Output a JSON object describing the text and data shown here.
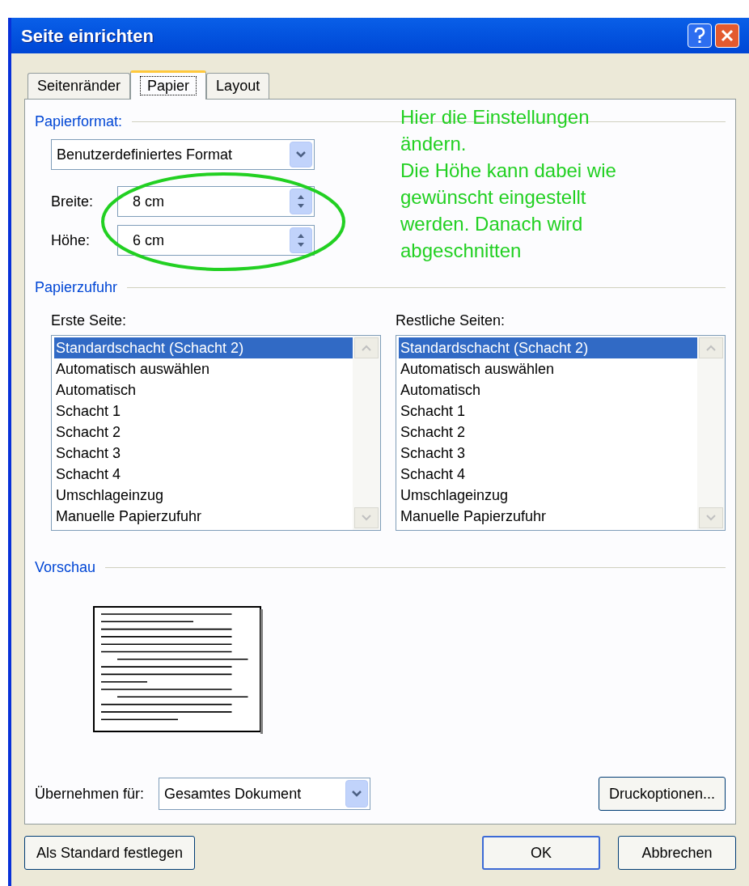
{
  "window": {
    "title": "Seite einrichten"
  },
  "tabs": [
    {
      "label": "Seitenränder",
      "selected": false
    },
    {
      "label": "Papier",
      "selected": true
    },
    {
      "label": "Layout",
      "selected": false
    }
  ],
  "paper_format": {
    "heading": "Papierformat:",
    "format": "Benutzerdefiniertes Format",
    "width_label": "Breite:",
    "width_value": "8 cm",
    "height_label": "Höhe:",
    "height_value": "6 cm"
  },
  "annotation": {
    "paragraphs": [
      "Hier die Einstellungen ändern.",
      "Die Höhe kann dabei wie gewünscht eingestellt werden. Danach wird abgeschnitten"
    ]
  },
  "paper_source": {
    "heading": "Papierzufuhr",
    "lists": [
      {
        "label": "Erste Seite:",
        "items": [
          {
            "text": "Standardschacht (Schacht 2)",
            "selected": true
          },
          {
            "text": "Automatisch auswählen",
            "selected": false
          },
          {
            "text": "Automatisch",
            "selected": false
          },
          {
            "text": "Schacht 1",
            "selected": false
          },
          {
            "text": "Schacht 2",
            "selected": false
          },
          {
            "text": "Schacht 3",
            "selected": false
          },
          {
            "text": "Schacht 4",
            "selected": false
          },
          {
            "text": "Umschlageinzug",
            "selected": false
          },
          {
            "text": "Manuelle Papierzufuhr",
            "selected": false
          }
        ]
      },
      {
        "label": "Restliche Seiten:",
        "items": [
          {
            "text": "Standardschacht (Schacht 2)",
            "selected": true
          },
          {
            "text": "Automatisch auswählen",
            "selected": false
          },
          {
            "text": "Automatisch",
            "selected": false
          },
          {
            "text": "Schacht 1",
            "selected": false
          },
          {
            "text": "Schacht 2",
            "selected": false
          },
          {
            "text": "Schacht 3",
            "selected": false
          },
          {
            "text": "Schacht 4",
            "selected": false
          },
          {
            "text": "Umschlageinzug",
            "selected": false
          },
          {
            "text": "Manuelle Papierzufuhr",
            "selected": false
          }
        ]
      }
    ]
  },
  "preview": {
    "heading": "Vorschau"
  },
  "apply_to": {
    "label": "Übernehmen für:",
    "value": "Gesamtes Dokument"
  },
  "print_options_button": "Druckoptionen...",
  "buttons": {
    "default": "Als Standard festlegen",
    "ok": "OK",
    "cancel": "Abbrechen"
  }
}
